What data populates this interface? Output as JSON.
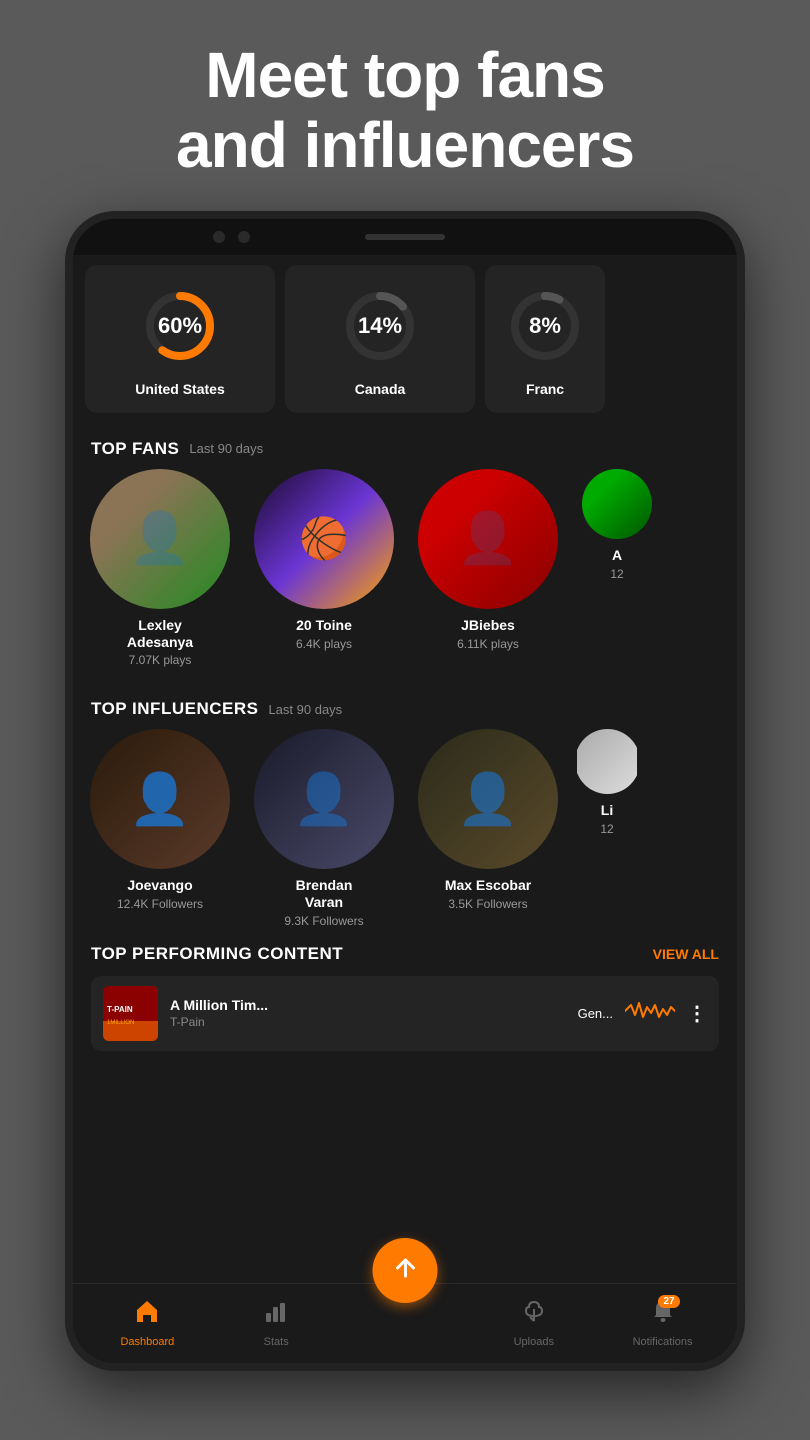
{
  "hero": {
    "title": "Meet top fans\nand influencers"
  },
  "stats": [
    {
      "id": "us",
      "percent": "60%",
      "label": "United States",
      "dashoffset": "75",
      "color": "#FF7A00"
    },
    {
      "id": "ca",
      "percent": "14%",
      "label": "Canada",
      "dashoffset": "162",
      "color": "#555"
    },
    {
      "id": "fr",
      "percent": "8%",
      "label": "Franc",
      "dashoffset": "173",
      "color": "#555"
    }
  ],
  "topFans": {
    "title": "TOP FANS",
    "subtitle": "Last 90 days",
    "items": [
      {
        "name": "Lexley\nAdesanya",
        "stat": "7.07K plays"
      },
      {
        "name": "20 Toine",
        "stat": "6.4K plays"
      },
      {
        "name": "JBiebes",
        "stat": "6.11K plays"
      },
      {
        "name": "A",
        "stat": "12"
      }
    ]
  },
  "topInfluencers": {
    "title": "TOP INFLUENCERS",
    "subtitle": "Last 90 days",
    "items": [
      {
        "name": "Joevango",
        "stat": "12.4K Followers"
      },
      {
        "name": "Brendan\nVaran",
        "stat": "9.3K Followers"
      },
      {
        "name": "Max Escobar",
        "stat": "3.5K Followers"
      },
      {
        "name": "Li",
        "stat": "12"
      }
    ]
  },
  "topContent": {
    "title": "TOP PERFORMING CONTENT",
    "viewAll": "VIEW ALL",
    "item": {
      "title": "A Million Tim...",
      "artist": "T-Pain",
      "genre": "Gen..."
    }
  },
  "bottomNav": {
    "items": [
      {
        "label": "Dashboard",
        "active": true,
        "icon": "house"
      },
      {
        "label": "Stats",
        "active": false,
        "icon": "bar-chart"
      },
      {
        "label": "",
        "active": false,
        "icon": "upload-fab"
      },
      {
        "label": "Uploads",
        "active": false,
        "icon": "music-note"
      },
      {
        "label": "Notifications",
        "active": false,
        "icon": "bell",
        "badge": "27"
      }
    ]
  }
}
